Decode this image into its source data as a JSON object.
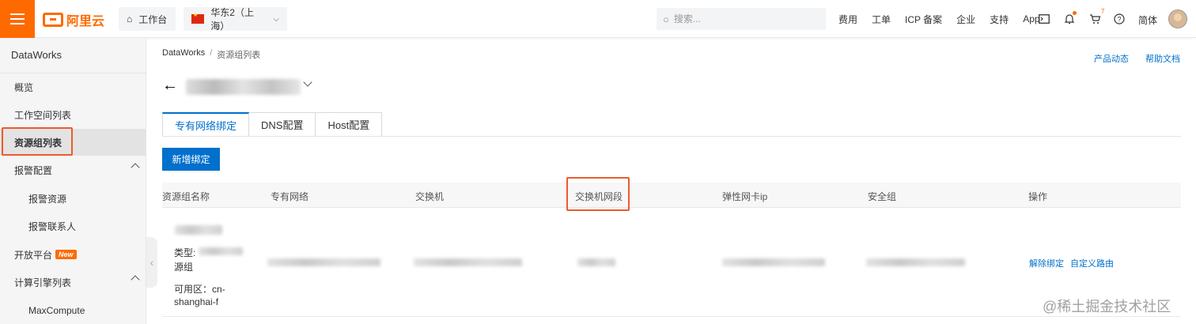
{
  "topbar": {
    "brand": "阿里云",
    "workbench": "工作台",
    "region": "华东2（上海）",
    "search_placeholder": "搜索...",
    "links": [
      "费用",
      "工单",
      "ICP 备案",
      "企业",
      "支持",
      "App"
    ],
    "cart_count": "7",
    "language": "简体"
  },
  "sidebar": {
    "title": "DataWorks",
    "items": [
      {
        "label": "概览"
      },
      {
        "label": "工作空间列表"
      },
      {
        "label": "资源组列表"
      },
      {
        "label": "报警配置"
      },
      {
        "label": "报警资源"
      },
      {
        "label": "报警联系人"
      },
      {
        "label": "开放平台",
        "badge": "New"
      },
      {
        "label": "计算引擎列表"
      },
      {
        "label": "MaxCompute"
      }
    ]
  },
  "breadcrumb": {
    "root": "DataWorks",
    "separator": "/",
    "current": "资源组列表"
  },
  "header_links": {
    "product_news": "产品动态",
    "help_docs": "帮助文档"
  },
  "tabs": [
    "专有网络绑定",
    "DNS配置",
    "Host配置"
  ],
  "actions": {
    "new_binding": "新增绑定"
  },
  "table": {
    "columns": [
      "资源组名称",
      "专有网络",
      "交换机",
      "交换机网段",
      "弹性网卡ip",
      "安全组",
      "操作"
    ],
    "row": {
      "type_label": "类型:",
      "type_suffix": "源组",
      "zone_label": "可用区：cn-",
      "zone_value": "shanghai-f",
      "action_unbind": "解除绑定",
      "action_route": "自定义路由"
    }
  },
  "watermark": "@稀土掘金技术社区",
  "colors": {
    "brand": "#ff6a00",
    "primary": "#0070cc",
    "highlight_box": "#ee5a2b"
  }
}
